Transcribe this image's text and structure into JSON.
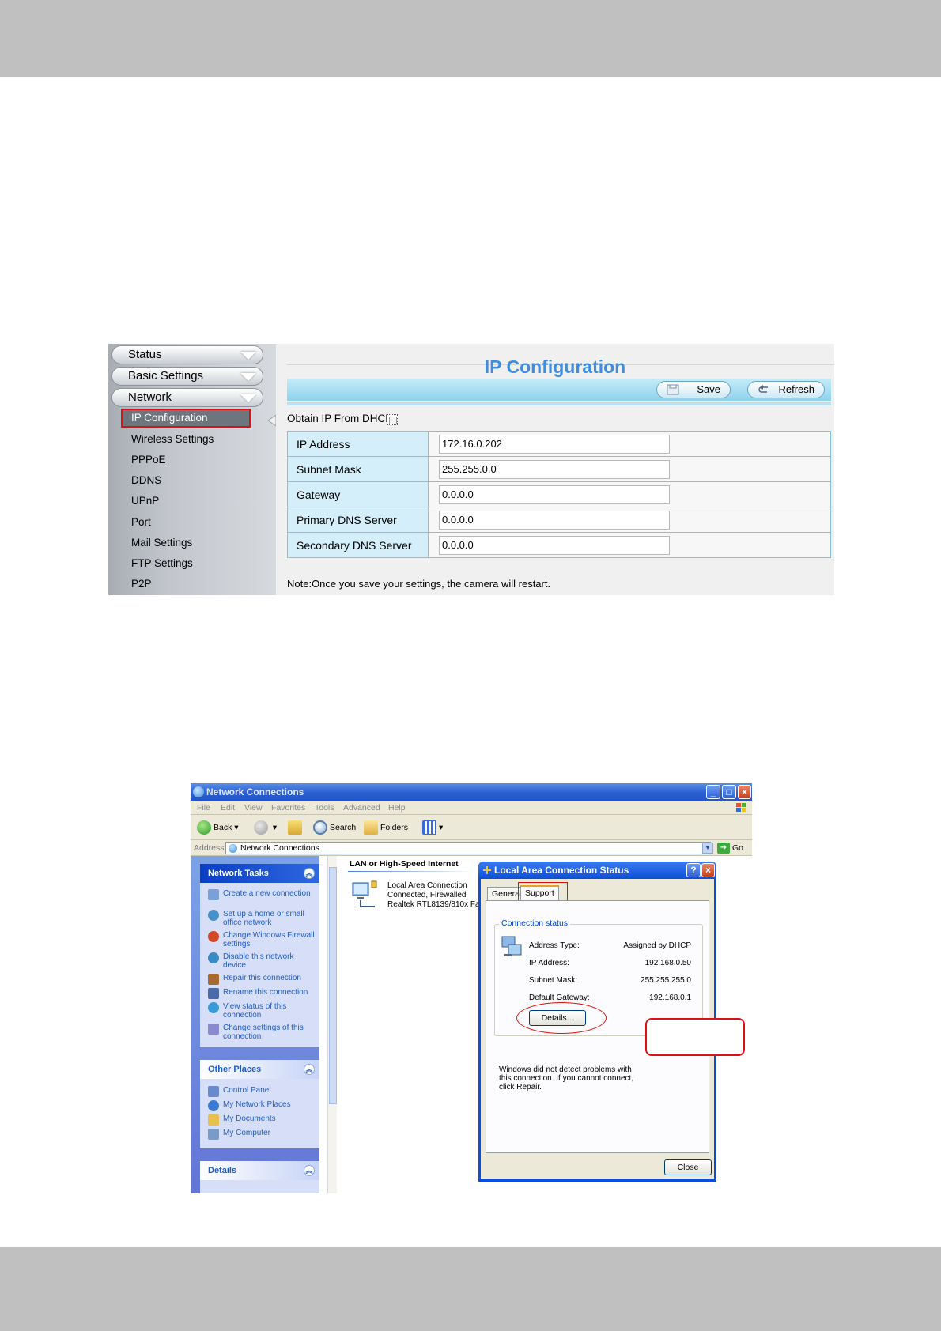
{
  "camera_ui": {
    "sidebar": {
      "menus": [
        "Status",
        "Basic Settings",
        "Network"
      ],
      "items": [
        "IP Configuration",
        "Wireless Settings",
        "PPPoE",
        "DDNS",
        "UPnP",
        "Port",
        "Mail Settings",
        "FTP Settings",
        "P2P"
      ],
      "active_item": "IP Configuration"
    },
    "title": "IP Configuration",
    "buttons": {
      "save": "Save",
      "refresh": "Refresh"
    },
    "dhcp_label": "Obtain IP From DHCP",
    "dhcp_checked": false,
    "fields": [
      {
        "label": "IP Address",
        "value": "172.16.0.202"
      },
      {
        "label": "Subnet Mask",
        "value": "255.255.0.0"
      },
      {
        "label": "Gateway",
        "value": "0.0.0.0"
      },
      {
        "label": "Primary DNS Server",
        "value": "0.0.0.0"
      },
      {
        "label": "Secondary DNS Server",
        "value": "0.0.0.0"
      }
    ],
    "note": "Note:Once you save your settings, the camera will restart.",
    "colors": {
      "title": "#3d8ee0",
      "highlight": "#e01010",
      "table_border": "#7fc3e3"
    }
  },
  "xp_window": {
    "title": "Network Connections",
    "menu": [
      "File",
      "Edit",
      "View",
      "Favorites",
      "Tools",
      "Advanced",
      "Help"
    ],
    "toolbar": {
      "back": "Back",
      "search": "Search",
      "folders": "Folders"
    },
    "address_label": "Address",
    "address_value": "Network Connections",
    "go_label": "Go",
    "network_tasks": {
      "header": "Network Tasks",
      "links": [
        "Create a new connection",
        "Set up a home or small office network",
        "Change Windows Firewall settings",
        "Disable this network device",
        "Repair this connection",
        "Rename this connection",
        "View status of this connection",
        "Change settings of this connection"
      ]
    },
    "other_places": {
      "header": "Other Places",
      "links": [
        "Control Panel",
        "My Network Places",
        "My Documents",
        "My Computer"
      ]
    },
    "details_header": "Details",
    "lan_section": "LAN or High-Speed Internet",
    "connection": {
      "name": "Local Area Connection",
      "status": "Connected, Firewalled",
      "device": "Realtek RTL8139/810x Fa"
    }
  },
  "dialog": {
    "title": "Local Area Connection Status",
    "tabs": [
      "General",
      "Support"
    ],
    "selected_tab": "Support",
    "group_label": "Connection status",
    "rows": [
      {
        "label": "Address Type:",
        "value": "Assigned by DHCP"
      },
      {
        "label": "IP Address:",
        "value": "192.168.0.50"
      },
      {
        "label": "Subnet Mask:",
        "value": "255.255.255.0"
      },
      {
        "label": "Default Gateway:",
        "value": "192.168.0.1"
      }
    ],
    "details_button": "Details...",
    "diagnostic": "Windows did not detect problems with this connection. If you cannot connect, click Repair.",
    "close_button": "Close"
  }
}
